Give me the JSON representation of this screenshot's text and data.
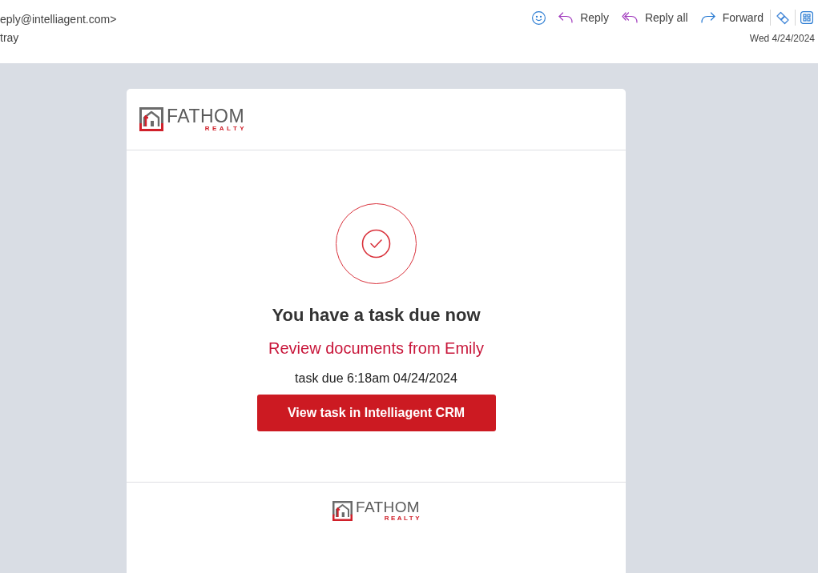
{
  "message_header": {
    "sender_address": "eply@intelliagent.com>",
    "recipient": "tray",
    "actions": [
      {
        "kind": "react"
      },
      {
        "kind": "reply",
        "label": "Reply"
      },
      {
        "kind": "reply_all",
        "label": "Reply all"
      },
      {
        "kind": "forward",
        "label": "Forward"
      }
    ],
    "add_ins": [
      {
        "kind": "loop"
      },
      {
        "kind": "apps"
      }
    ],
    "date": "Wed 4/24/2024"
  },
  "email": {
    "header_logo": {
      "name": "FATHOM",
      "tagline": "REALTY"
    },
    "title": "You have a task due now",
    "task_name": "Review documents from Emily",
    "due_text": "task due 6:18am 04/24/2024",
    "button": "View task in Intelliagent CRM",
    "footer_logo": {
      "name": "FATHOM",
      "tagline": "REALTY"
    }
  }
}
